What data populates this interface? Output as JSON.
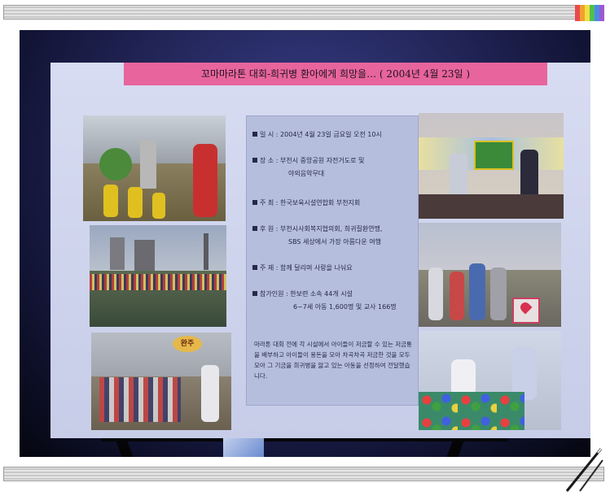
{
  "banner": {
    "text": "꼬마마라톤 대회-희귀병 환아에게 희망을… ( 2004년 4월 23일 )"
  },
  "info": {
    "rows": [
      {
        "label": "일 시",
        "value": "2004년 4월 23일 금요일 오전 10시"
      },
      {
        "label": "장 소",
        "value": "부천시 중앙공원 자전거도로 및"
      },
      {
        "label": "",
        "value": "야외음악무대"
      },
      {
        "label": "주 최",
        "value": "한국보육시설연합회 부천지회"
      },
      {
        "label": "후 원",
        "value": "부천시사회복지협의회, 희귀질환연맹,"
      },
      {
        "label": "",
        "value": "SBS 세상에서 가장 아름다운 여행"
      },
      {
        "label": "주 제",
        "value": "함께 달리며 사랑을 나눠요"
      },
      {
        "label": "참가인원",
        "value": "한보련 소속 44개 시설"
      },
      {
        "label": "",
        "value": "6~7세 아동 1,600명 및 교사 166명"
      }
    ],
    "description": "마라톤 대회 전에 각 시설에서 아이들이 저금할 수 있는 저금통을 배부하고 아이들이 용돈을 모아 차곡차곡 저금한 것을 모두 모아 그 기금을 희귀병을 앓고 있는 아동을 선정하여 전달했습니다."
  },
  "photos": {
    "sign_text": "완주"
  },
  "colors": {
    "banner": "#e8649c",
    "infobox": "#b6bedd",
    "board": "#d0d6ee",
    "background": "#14163a"
  },
  "crayon_colors": [
    "#e84a4a",
    "#f0a030",
    "#f0e040",
    "#50c050",
    "#4a8ae8",
    "#9a5ad0"
  ]
}
